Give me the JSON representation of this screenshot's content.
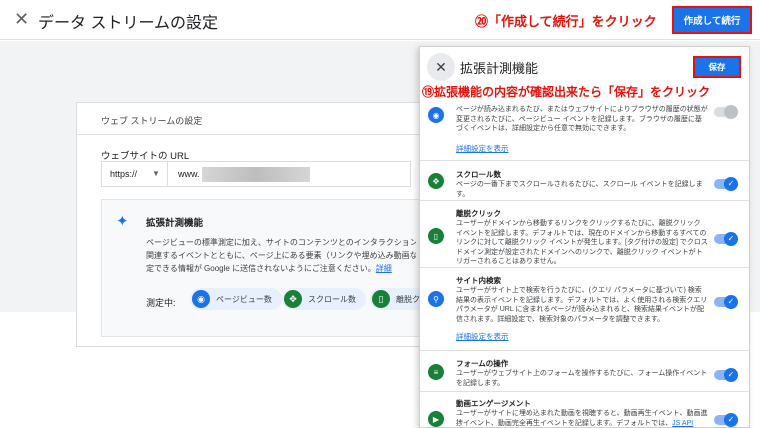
{
  "header": {
    "close_icon": "close-icon",
    "title": "データ ストリームの設定",
    "annotation": "⑳「作成して続行」をクリック",
    "continue_button": "作成して続行"
  },
  "stream_card": {
    "heading": "ウェブ ストリームの設定",
    "url_label": "ウェブサイトの URL",
    "protocol": "https://",
    "url_value": "www.",
    "enhanced": {
      "title": "拡張計測機能",
      "description": "ページビューの標準測定に加え、サイトのコンテンツとのインタラクションを自",
      "description2": "関連するイベントとともに、ページ上にある要素（リンクや埋め込み動画など）",
      "description3": "定できる情報が Google に送信されないようにご注意ください。",
      "detail_link": "詳細",
      "measure_label": "測定中:",
      "chips": [
        {
          "label": "ページビュー数",
          "color": "#1a73e8",
          "icon": "eye-icon"
        },
        {
          "label": "スクロール数",
          "color": "#188038",
          "icon": "target-icon"
        },
        {
          "label": "離脱クリ",
          "color": "#188038",
          "icon": "mouse-icon"
        }
      ]
    }
  },
  "panel": {
    "title": "拡張計測機能",
    "save_button": "保存",
    "annotation": "⑲拡張機能の内容が確認出来たら「保存」をクリック",
    "sections": [
      {
        "name": "page-views",
        "title": "",
        "desc": "ページが読み込まれるたび、またはウェブサイトによりブラウザの履歴の状態が変更されるたびに、ページビュー イベントを記録します。ブラウザの履歴に基づくイベントは、詳細設定から任意で無効にできます。",
        "link": "詳細設定を表示",
        "icon": "eye-icon",
        "on": false
      },
      {
        "name": "scrolls",
        "title": "スクロール数",
        "desc": "ページの一番下までスクロールされるたびに、スクロール イベントを記録します。",
        "icon": "target-icon",
        "on": true
      },
      {
        "name": "outbound-clicks",
        "title": "離脱クリック",
        "desc": "ユーザーがドメインから移動するリンクをクリックするたびに、離脱クリック イベントを記録します。デフォルトでは、現在のドメインから移動するすべてのリンクに対して離脱クリック イベントが発生します。[タグ付けの設定] でクロスドメイン測定が設定されたドメインへのリンクで、離脱クリック イベントがトリガーされることはありません。",
        "icon": "mouse-icon",
        "on": true
      },
      {
        "name": "site-search",
        "title": "サイト内検索",
        "desc": "ユーザーがサイト上で検索を行うたびに、(クエリ パラメータに基づいて) 検索結果の表示イベントを記録します。デフォルトでは、よく使用される検索クエリ パラメータが URL に含まれるページが読み込まれると、検索結果イベントが配信されます。詳細設定で、検索対象のパラメータを調整できます。",
        "link": "詳細設定を表示",
        "icon": "search-icon",
        "on": true
      },
      {
        "name": "form-interactions",
        "title": "フォームの操作",
        "desc": "ユーザーがウェブサイト上のフォームを操作するたびに、フォーム操作イベントを記録します。",
        "icon": "form-icon",
        "on": true
      },
      {
        "name": "video-engagement",
        "title": "動画エンゲージメント",
        "desc": "ユーザーがサイトに埋め込まれた動画を視聴すると、動画再生イベント、動画進捗イベント、動画完全再生イベントを記録します。デフォルトでは、",
        "link": "JS API",
        "icon": "play-icon",
        "on": true
      }
    ]
  },
  "colors": {
    "accent": "#1a73e8",
    "annotation": "#e8120c",
    "green": "#188038"
  }
}
